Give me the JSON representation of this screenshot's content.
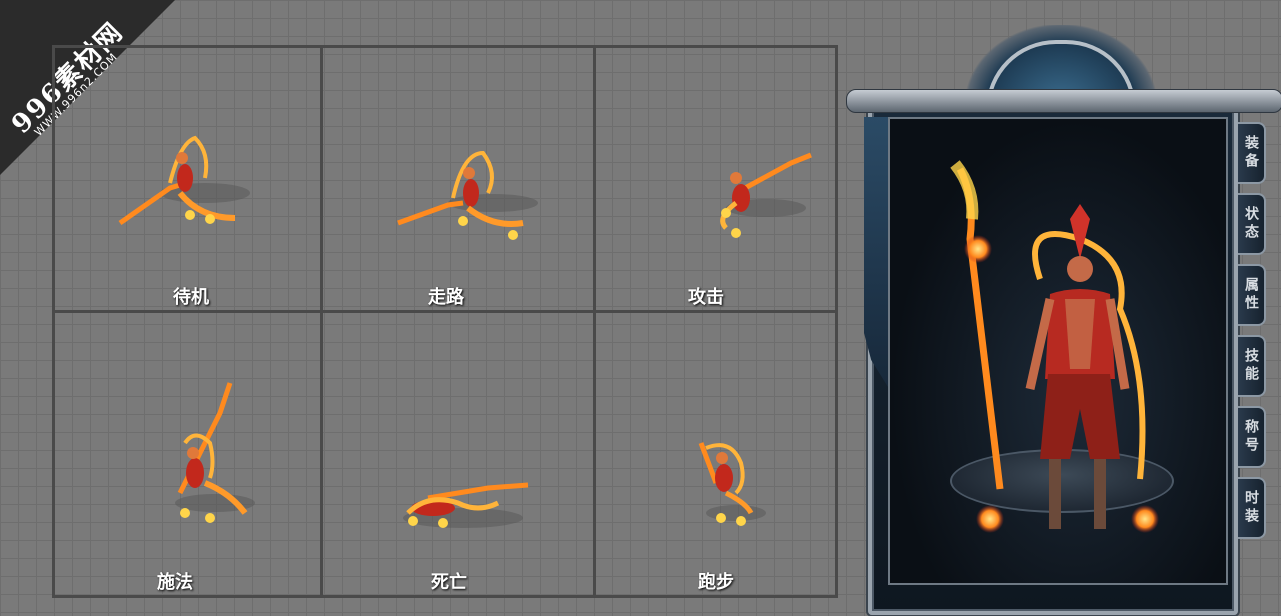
{
  "watermark": {
    "title": "996素材网",
    "url": "WWW.996n2.COM"
  },
  "animations": [
    {
      "label": "待机"
    },
    {
      "label": "走路"
    },
    {
      "label": "攻击"
    },
    {
      "label": "施法"
    },
    {
      "label": "死亡"
    },
    {
      "label": "跑步"
    }
  ],
  "character_panel": {
    "tabs": [
      {
        "label": "装备"
      },
      {
        "label": "状态"
      },
      {
        "label": "属性"
      },
      {
        "label": "技能"
      },
      {
        "label": "称号"
      },
      {
        "label": "时装"
      }
    ]
  },
  "colors": {
    "flame": "#ff8a1e",
    "flame_core": "#ffd54a",
    "robe": "#c2281c",
    "panel_frame": "#9aa4ae",
    "panel_bg": "#0e1720"
  },
  "icons": {
    "character_sprite": "fire-monk-sprite-icon",
    "character_model": "fire-monk-model-icon"
  }
}
